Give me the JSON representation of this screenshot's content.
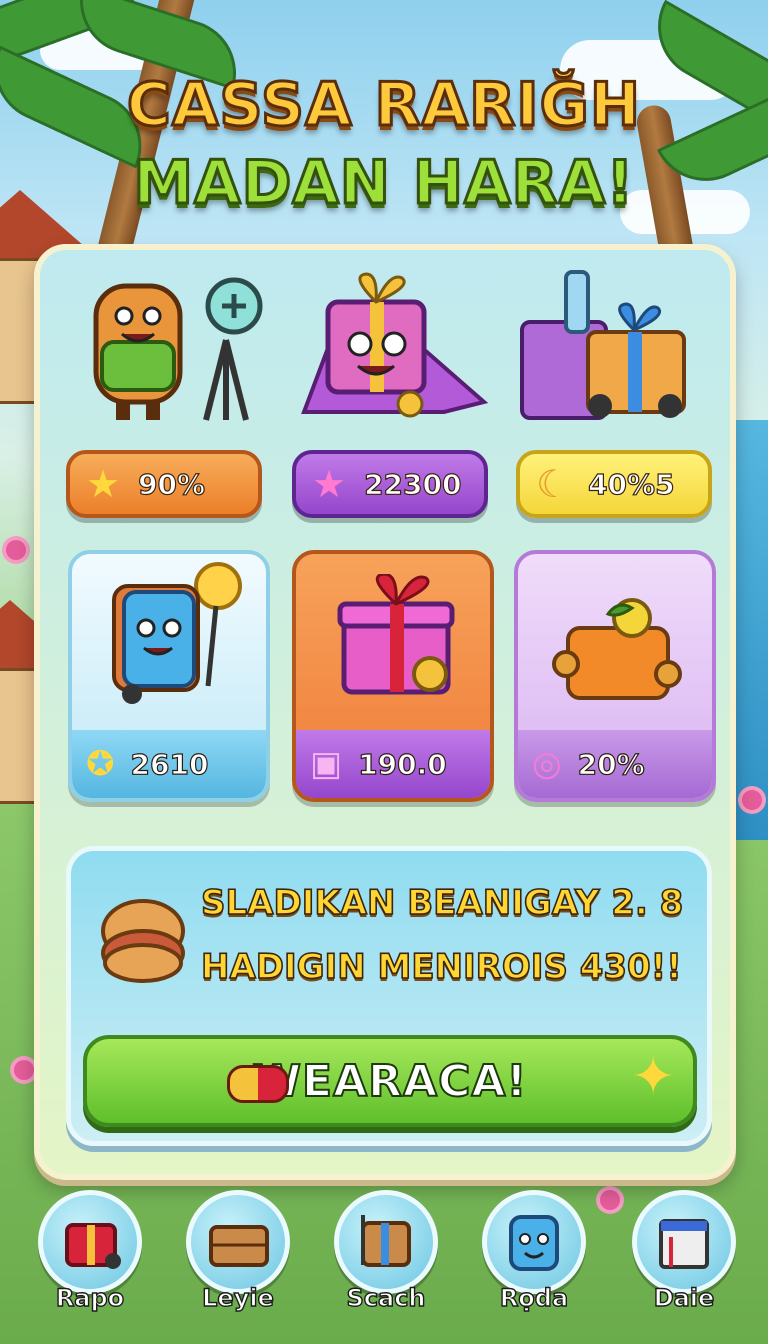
{
  "title": {
    "line1": "CASSA RARIĞH",
    "line2": "MADAN HARA!"
  },
  "stats": [
    {
      "icon": "star-icon",
      "value": "90%",
      "color": "#f3923b"
    },
    {
      "icon": "pink-star-icon",
      "value": "22300",
      "color": "#a458d6"
    },
    {
      "icon": "moon-icon",
      "value": "40%5",
      "color": "#f7e24b"
    }
  ],
  "cards": [
    {
      "icon": "star-badge-icon",
      "value": "2610",
      "color": "#7cc8ea"
    },
    {
      "icon": "chest-icon",
      "value": "190.0",
      "color": "#a04dc9"
    },
    {
      "icon": "ring-icon",
      "value": "20%",
      "color": "#b57ad8"
    }
  ],
  "promo": {
    "line1": "SLADIKAN BEANIGAY 2. 8",
    "line2": "HADIGIN MENIROIS 430!!",
    "button_label": "WEARACA!"
  },
  "nav": [
    {
      "label": "Rapo",
      "icon": "gift-box-icon"
    },
    {
      "label": "Leyie",
      "icon": "crate-icon"
    },
    {
      "label": "Scach",
      "icon": "cart-icon"
    },
    {
      "label": "Rọda",
      "icon": "character-bag-icon"
    },
    {
      "label": "Daie",
      "icon": "book-stack-icon"
    }
  ]
}
